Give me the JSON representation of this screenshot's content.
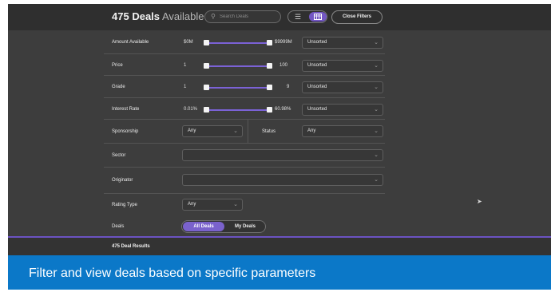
{
  "header": {
    "deals_count": "475",
    "deals_suffix_bold": "Deals",
    "deals_suffix": "Available",
    "search_placeholder": "Search Deals",
    "close_filters_label": "Close Filters"
  },
  "filters": {
    "amount": {
      "label": "Amount Available",
      "min": "$0M",
      "max": "$9999M",
      "sort": "Unsorted"
    },
    "price": {
      "label": "Price",
      "min": "1",
      "max": "100",
      "sort": "Unsorted"
    },
    "grade": {
      "label": "Grade",
      "min": "1",
      "max": "9",
      "sort": "Unsorted"
    },
    "interest": {
      "label": "Interest Rate",
      "min": "0.01%",
      "max": "60.98%",
      "sort": "Unsorted"
    },
    "sponsorship": {
      "label": "Sponsorship",
      "value": "Any"
    },
    "status": {
      "label": "Status",
      "value": "Any"
    },
    "sector": {
      "label": "Sector",
      "value": ""
    },
    "originator": {
      "label": "Originator",
      "value": ""
    },
    "rating_type": {
      "label": "Rating Type",
      "value": "Any"
    },
    "deals": {
      "label": "Deals",
      "options": [
        "All Deals",
        "My Deals"
      ],
      "selected": "All Deals"
    }
  },
  "results": {
    "text": "475 Deal Results"
  },
  "caption": {
    "text": "Filter and view deals based on specific parameters"
  },
  "colors": {
    "accent": "#7357c4",
    "caption_bg": "#0b78c8",
    "panel_bg": "#3d3d3d"
  }
}
